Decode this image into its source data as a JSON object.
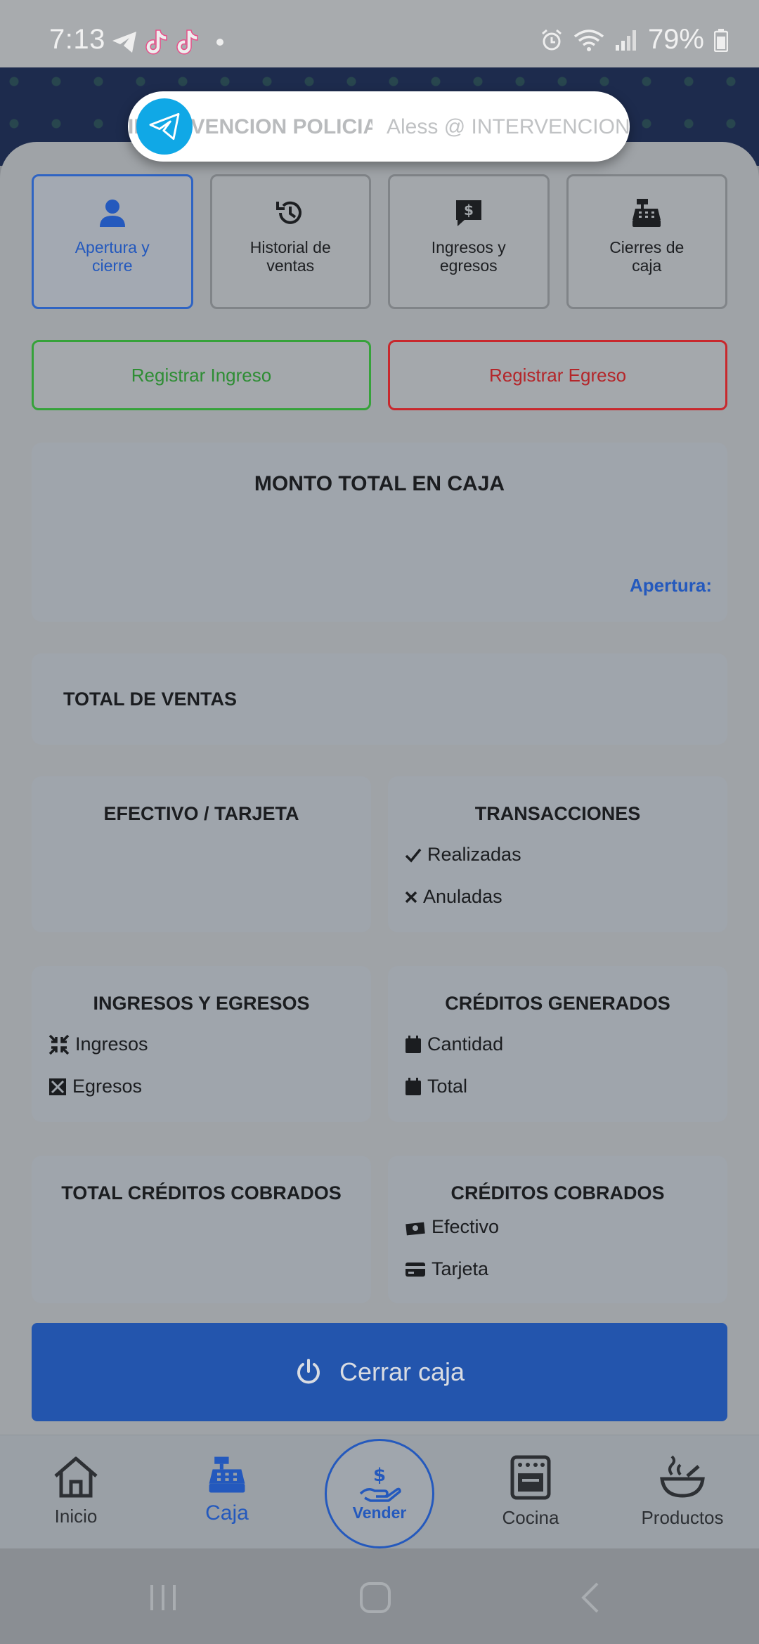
{
  "status_bar": {
    "time": "7:13",
    "battery": "79%"
  },
  "notification": {
    "title": "INTERVENCION POLICIA...",
    "subtitle": "Aless @ INTERVENCION P"
  },
  "tabs": [
    {
      "label": "Apertura y cierre",
      "icon": "user-icon",
      "active": true
    },
    {
      "label": "Historial de ventas",
      "icon": "history-icon",
      "active": false
    },
    {
      "label": "Ingresos y egresos",
      "icon": "dollar-message-icon",
      "active": false
    },
    {
      "label": "Cierres de caja",
      "icon": "cash-register-icon",
      "active": false
    }
  ],
  "actions": {
    "ingreso": "Registrar Ingreso",
    "egreso": "Registrar Egreso"
  },
  "monto": {
    "title": "MONTO TOTAL EN CAJA",
    "apertura_label": "Apertura:"
  },
  "ventas": {
    "title": "TOTAL DE VENTAS"
  },
  "efectivo_tarjeta": {
    "title": "EFECTIVO / TARJETA"
  },
  "transacciones": {
    "title": "TRANSACCIONES",
    "realizadas": "Realizadas",
    "anuladas": "Anuladas"
  },
  "ingresos_egresos": {
    "title": "INGRESOS Y EGRESOS",
    "ingresos": "Ingresos",
    "egresos": "Egresos"
  },
  "creditos_generados": {
    "title": "CRÉDITOS GENERADOS",
    "cantidad": "Cantidad",
    "total": "Total"
  },
  "total_creditos_cobrados": {
    "title": "TOTAL CRÉDITOS COBRADOS"
  },
  "creditos_cobrados": {
    "title": "CRÉDITOS COBRADOS",
    "efectivo": "Efectivo",
    "tarjeta": "Tarjeta"
  },
  "cerrar_button": "Cerrar caja",
  "bottom_nav": {
    "inicio": "Inicio",
    "caja": "Caja",
    "vender": "Vender",
    "cocina": "Cocina",
    "productos": "Productos"
  },
  "colors": {
    "accent": "#2459bd",
    "ingreso": "#36a23a",
    "egreso": "#c8282d"
  }
}
